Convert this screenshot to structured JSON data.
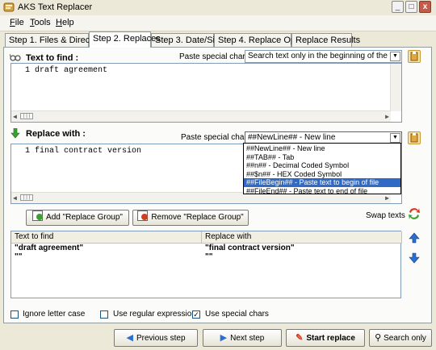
{
  "window": {
    "title": "AKS Text Replacer",
    "controls": [
      "_",
      "□",
      "x"
    ]
  },
  "menu": [
    {
      "label": "File",
      "key": "F"
    },
    {
      "label": "Tools",
      "key": "T"
    },
    {
      "label": "Help",
      "key": "H"
    }
  ],
  "tabs": [
    {
      "label": "Step 1. Files & Directories",
      "active": false
    },
    {
      "label": "Step 2. Replaces",
      "active": true
    },
    {
      "label": "Step 3. Date/Size",
      "active": false
    },
    {
      "label": "Step 4. Replace Options",
      "active": false
    },
    {
      "label": "Replace Results",
      "active": false
    }
  ],
  "find": {
    "label": "Text to find :",
    "paste_label": "Paste special char",
    "mode_value": "Search text only in the beginning of the file",
    "line_number": "1",
    "text": "draft agreement"
  },
  "replace": {
    "label": "Replace with :",
    "paste_label": "Paste special char",
    "special_value": "##NewLine## - New line",
    "line_number": "1",
    "text": "final contract version"
  },
  "special_char_options": [
    {
      "label": "##NewLine## - New line",
      "selected": false
    },
    {
      "label": "##TAB## - Tab",
      "selected": false
    },
    {
      "label": "##n## - Decimal Coded Symbol",
      "selected": false
    },
    {
      "label": "##$n## - HEX Coded Symbol",
      "selected": false
    },
    {
      "label": "##FileBegin## - Paste text to begin of file",
      "selected": true
    },
    {
      "label": "##FileEnd## - Paste text to end of file",
      "selected": false
    }
  ],
  "group_buttons": {
    "add": "Add \"Replace Group\"",
    "remove": "Remove \"Replace Group\"",
    "swap": "Swap texts"
  },
  "groups_table": {
    "headers": [
      "Text to find",
      "Replace with"
    ],
    "rows": [
      [
        "\"draft agreement\"",
        "\"final contract version\""
      ],
      [
        "\"\"",
        "\"\""
      ]
    ]
  },
  "options": [
    {
      "label": "Ignore letter case",
      "checked": false
    },
    {
      "label": "Use regular expressions",
      "checked": false
    },
    {
      "label": "Use special chars",
      "checked": true
    }
  ],
  "nav": {
    "previous": "Previous step",
    "next": "Next step",
    "start": "Start replace",
    "search": "Search only"
  },
  "colors": {
    "selection": "#316ac5",
    "panel": "#fbfbf9",
    "window": "#ece9d8",
    "find_arrow": "#3aa030",
    "blue_arrow": "#2a6fd0"
  }
}
